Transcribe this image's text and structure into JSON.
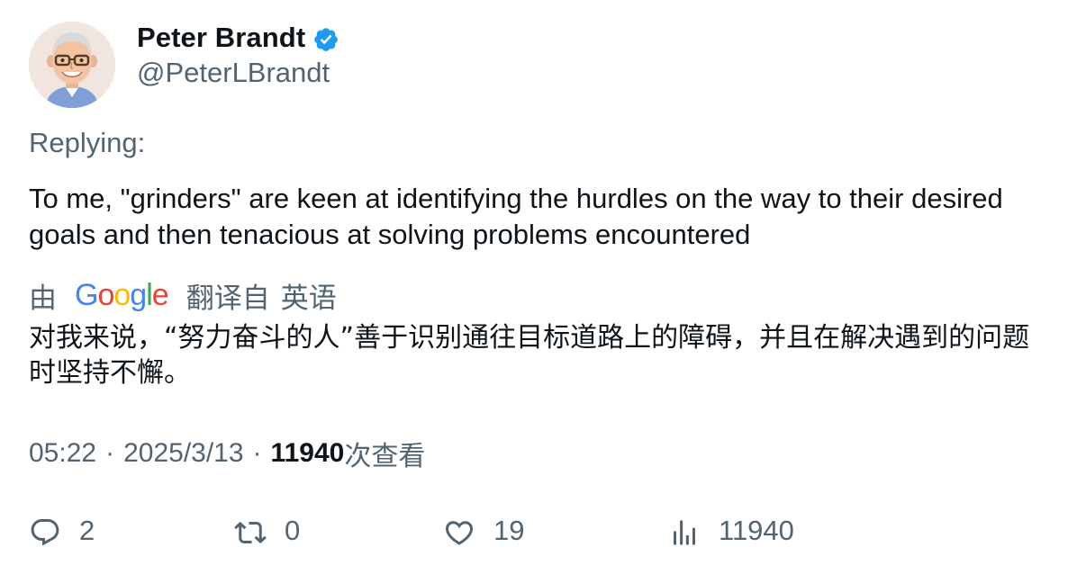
{
  "author": {
    "display_name": "Peter Brandt",
    "handle": "@PeterLBrandt",
    "verified_icon": "verified-badge-icon",
    "badge_color": "#1d9bf0"
  },
  "replying_label": "Replying:",
  "tweet_text": "To me, \"grinders\" are keen at identifying the hurdles on the way to their desired goals and then tenacious at solving problems encountered",
  "translation": {
    "prefix": "由",
    "provider": "Google",
    "translated_from": "翻译自",
    "language": "英语",
    "text": "对我来说，“努力奋斗的人”善于识别通往目标道路上的障碍，并且在解决遇到的问题时坚持不懈。"
  },
  "meta": {
    "time": "05:22",
    "date": "2025/3/13",
    "views_count": "11940",
    "views_label": "次查看",
    "separator": "·"
  },
  "actions": {
    "reply_count": "2",
    "retweet_count": "0",
    "like_count": "19",
    "views_count": "11940"
  },
  "colors": {
    "primary_text": "#0f1419",
    "secondary_text": "#536471",
    "accent": "#1d9bf0"
  }
}
